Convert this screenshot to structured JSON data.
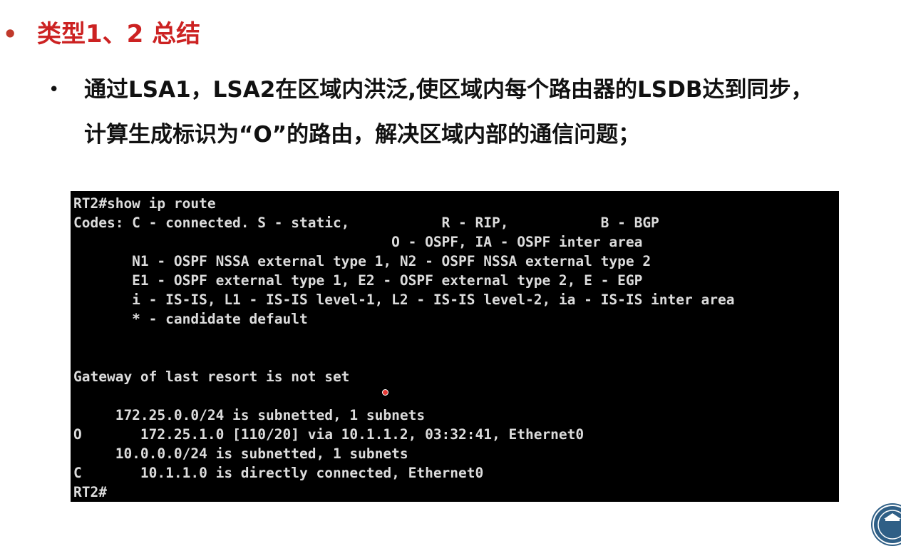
{
  "slide": {
    "bullet_symbol": "•",
    "title": "类型1、2 总结",
    "sub_bullet_symbol": "•",
    "point_line1": "通过LSA1，LSA2在区域内洪泛,使区域内每个路由器的LSDB达到同步，",
    "point_line2": "计算生成标识为“O”的路由，解决区域内部的通信问题；"
  },
  "terminal": {
    "lines": [
      "RT2#show ip route",
      "Codes: C - connected. S - static,           R - RIP,           B - BGP",
      "                                      O - OSPF, IA - OSPF inter area",
      "       N1 - OSPF NSSA external type 1, N2 - OSPF NSSA external type 2",
      "       E1 - OSPF external type 1, E2 - OSPF external type 2, E - EGP",
      "       i - IS-IS, L1 - IS-IS level-1, L2 - IS-IS level-2, ia - IS-IS inter area",
      "       * - candidate default",
      "",
      "",
      "Gateway of last resort is not set",
      "",
      "     172.25.0.0/24 is subnetted, 1 subnets",
      "O       172.25.1.0 [110/20] via 10.1.1.2, 03:32:41, Ethernet0",
      "     10.0.0.0/24 is subnetted, 1 subnets",
      "C       10.1.1.0 is directly connected, Ethernet0",
      "RT2#"
    ]
  },
  "colors": {
    "title": "#cc2222",
    "terminal_bg": "#000000",
    "terminal_fg": "#dcdcdc"
  }
}
